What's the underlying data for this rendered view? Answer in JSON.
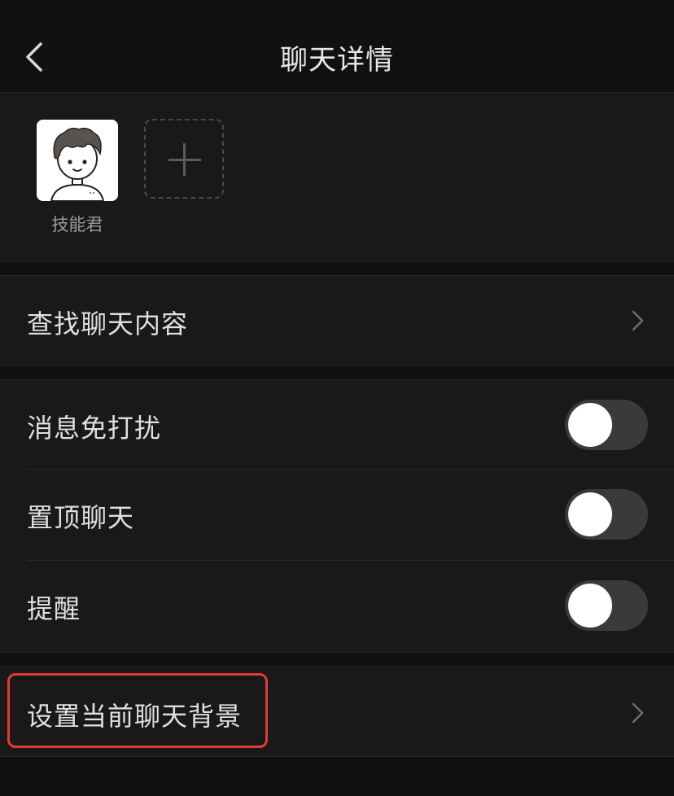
{
  "header": {
    "title": "聊天详情",
    "back_icon": "chevron-left-icon"
  },
  "members": {
    "items": [
      {
        "name": "技能君",
        "avatar": "cartoon-boy-avatar"
      }
    ],
    "add_icon": "plus-icon"
  },
  "search_row": {
    "label": "查找聊天内容"
  },
  "settings": {
    "items": [
      {
        "label": "消息免打扰",
        "toggle": false
      },
      {
        "label": "置顶聊天",
        "toggle": false
      },
      {
        "label": "提醒",
        "toggle": false
      }
    ]
  },
  "background_row": {
    "label": "设置当前聊天背景",
    "highlight_color": "#e53935"
  },
  "colors": {
    "page_bg": "#111111",
    "cell_bg": "#191919",
    "toggle_off": "#3a3a3a"
  }
}
